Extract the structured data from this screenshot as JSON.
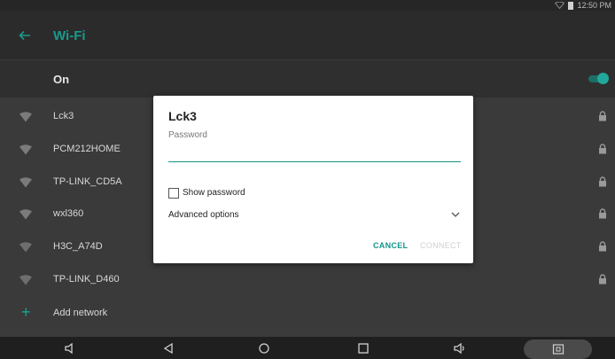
{
  "status_bar": {
    "time": "12:50 PM"
  },
  "app_bar": {
    "title": "Wi-Fi"
  },
  "master_switch": {
    "label": "On",
    "enabled": true
  },
  "networks": [
    {
      "name": "Lck3",
      "secured": true
    },
    {
      "name": "PCM212HOME",
      "secured": true
    },
    {
      "name": "TP-LINK_CD5A",
      "secured": true
    },
    {
      "name": "wxl360",
      "secured": true
    },
    {
      "name": "H3C_A74D",
      "secured": true
    },
    {
      "name": "TP-LINK_D460",
      "secured": true
    }
  ],
  "add_network_label": "Add network",
  "dialog": {
    "title": "Lck3",
    "password_label": "Password",
    "password_value": "",
    "show_password_label": "Show password",
    "show_password_checked": false,
    "advanced_options_label": "Advanced options",
    "cancel_label": "CANCEL",
    "connect_label": "CONNECT"
  },
  "colors": {
    "accent": "#14968a",
    "dialog_bg": "#ffffff"
  }
}
